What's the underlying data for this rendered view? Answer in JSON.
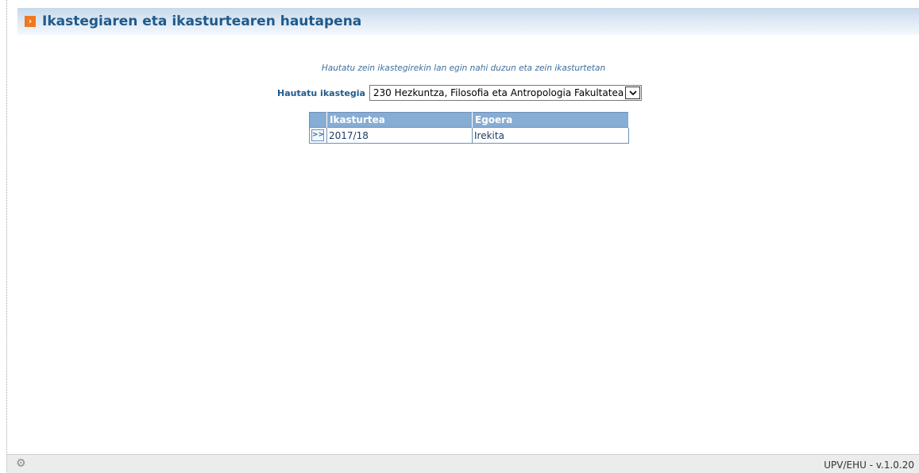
{
  "header": {
    "title": "Ikastegiaren eta ikasturtearen hautapena",
    "icon": "chevron-right-icon",
    "accent_color": "#f07820",
    "title_color": "#1f5a8b"
  },
  "instruction": "Hautatu zein ikastegirekin lan egin nahi duzun eta zein ikasturtetan",
  "school_select": {
    "label": "Hautatu ikastegia",
    "selected_value": "230 Hezkuntza, Filosofia eta Antropologia Fakultatea"
  },
  "table": {
    "columns": [
      "Ikasturtea",
      "Egoera"
    ],
    "rows": [
      {
        "button_label": ">>",
        "year": "2017/18",
        "status": "Irekita"
      }
    ],
    "header_color": "#86add3"
  },
  "footer": {
    "icon": "gear-icon",
    "version": "UPV/EHU - v.1.0.20"
  }
}
